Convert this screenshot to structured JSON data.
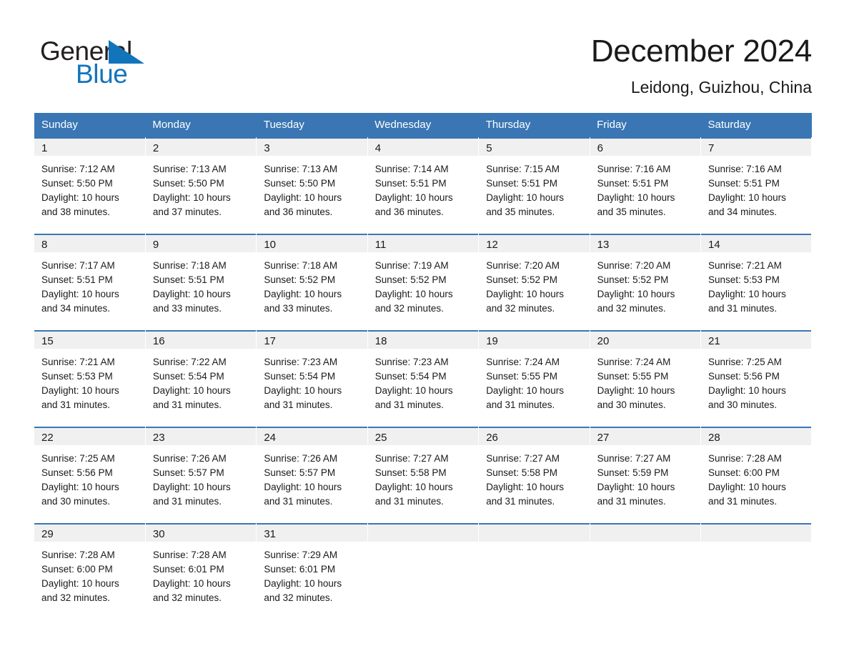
{
  "brand": {
    "name_dark": "General",
    "name_light": "Blue",
    "triangle_color": "#1275bc",
    "logo_icon": "triangle-icon"
  },
  "header": {
    "title": "December 2024",
    "subtitle": "Leidong, Guizhou, China"
  },
  "theme": {
    "header_blue": "#3a76b4",
    "date_band": "#f0f0f0",
    "text": "#1a1a1a"
  },
  "weekdays": [
    "Sunday",
    "Monday",
    "Tuesday",
    "Wednesday",
    "Thursday",
    "Friday",
    "Saturday"
  ],
  "weeks": [
    [
      {
        "date": "1",
        "sunrise": "Sunrise: 7:12 AM",
        "sunset": "Sunset: 5:50 PM",
        "daylight_line1": "Daylight: 10 hours",
        "daylight_line2": "and 38 minutes."
      },
      {
        "date": "2",
        "sunrise": "Sunrise: 7:13 AM",
        "sunset": "Sunset: 5:50 PM",
        "daylight_line1": "Daylight: 10 hours",
        "daylight_line2": "and 37 minutes."
      },
      {
        "date": "3",
        "sunrise": "Sunrise: 7:13 AM",
        "sunset": "Sunset: 5:50 PM",
        "daylight_line1": "Daylight: 10 hours",
        "daylight_line2": "and 36 minutes."
      },
      {
        "date": "4",
        "sunrise": "Sunrise: 7:14 AM",
        "sunset": "Sunset: 5:51 PM",
        "daylight_line1": "Daylight: 10 hours",
        "daylight_line2": "and 36 minutes."
      },
      {
        "date": "5",
        "sunrise": "Sunrise: 7:15 AM",
        "sunset": "Sunset: 5:51 PM",
        "daylight_line1": "Daylight: 10 hours",
        "daylight_line2": "and 35 minutes."
      },
      {
        "date": "6",
        "sunrise": "Sunrise: 7:16 AM",
        "sunset": "Sunset: 5:51 PM",
        "daylight_line1": "Daylight: 10 hours",
        "daylight_line2": "and 35 minutes."
      },
      {
        "date": "7",
        "sunrise": "Sunrise: 7:16 AM",
        "sunset": "Sunset: 5:51 PM",
        "daylight_line1": "Daylight: 10 hours",
        "daylight_line2": "and 34 minutes."
      }
    ],
    [
      {
        "date": "8",
        "sunrise": "Sunrise: 7:17 AM",
        "sunset": "Sunset: 5:51 PM",
        "daylight_line1": "Daylight: 10 hours",
        "daylight_line2": "and 34 minutes."
      },
      {
        "date": "9",
        "sunrise": "Sunrise: 7:18 AM",
        "sunset": "Sunset: 5:51 PM",
        "daylight_line1": "Daylight: 10 hours",
        "daylight_line2": "and 33 minutes."
      },
      {
        "date": "10",
        "sunrise": "Sunrise: 7:18 AM",
        "sunset": "Sunset: 5:52 PM",
        "daylight_line1": "Daylight: 10 hours",
        "daylight_line2": "and 33 minutes."
      },
      {
        "date": "11",
        "sunrise": "Sunrise: 7:19 AM",
        "sunset": "Sunset: 5:52 PM",
        "daylight_line1": "Daylight: 10 hours",
        "daylight_line2": "and 32 minutes."
      },
      {
        "date": "12",
        "sunrise": "Sunrise: 7:20 AM",
        "sunset": "Sunset: 5:52 PM",
        "daylight_line1": "Daylight: 10 hours",
        "daylight_line2": "and 32 minutes."
      },
      {
        "date": "13",
        "sunrise": "Sunrise: 7:20 AM",
        "sunset": "Sunset: 5:52 PM",
        "daylight_line1": "Daylight: 10 hours",
        "daylight_line2": "and 32 minutes."
      },
      {
        "date": "14",
        "sunrise": "Sunrise: 7:21 AM",
        "sunset": "Sunset: 5:53 PM",
        "daylight_line1": "Daylight: 10 hours",
        "daylight_line2": "and 31 minutes."
      }
    ],
    [
      {
        "date": "15",
        "sunrise": "Sunrise: 7:21 AM",
        "sunset": "Sunset: 5:53 PM",
        "daylight_line1": "Daylight: 10 hours",
        "daylight_line2": "and 31 minutes."
      },
      {
        "date": "16",
        "sunrise": "Sunrise: 7:22 AM",
        "sunset": "Sunset: 5:54 PM",
        "daylight_line1": "Daylight: 10 hours",
        "daylight_line2": "and 31 minutes."
      },
      {
        "date": "17",
        "sunrise": "Sunrise: 7:23 AM",
        "sunset": "Sunset: 5:54 PM",
        "daylight_line1": "Daylight: 10 hours",
        "daylight_line2": "and 31 minutes."
      },
      {
        "date": "18",
        "sunrise": "Sunrise: 7:23 AM",
        "sunset": "Sunset: 5:54 PM",
        "daylight_line1": "Daylight: 10 hours",
        "daylight_line2": "and 31 minutes."
      },
      {
        "date": "19",
        "sunrise": "Sunrise: 7:24 AM",
        "sunset": "Sunset: 5:55 PM",
        "daylight_line1": "Daylight: 10 hours",
        "daylight_line2": "and 31 minutes."
      },
      {
        "date": "20",
        "sunrise": "Sunrise: 7:24 AM",
        "sunset": "Sunset: 5:55 PM",
        "daylight_line1": "Daylight: 10 hours",
        "daylight_line2": "and 30 minutes."
      },
      {
        "date": "21",
        "sunrise": "Sunrise: 7:25 AM",
        "sunset": "Sunset: 5:56 PM",
        "daylight_line1": "Daylight: 10 hours",
        "daylight_line2": "and 30 minutes."
      }
    ],
    [
      {
        "date": "22",
        "sunrise": "Sunrise: 7:25 AM",
        "sunset": "Sunset: 5:56 PM",
        "daylight_line1": "Daylight: 10 hours",
        "daylight_line2": "and 30 minutes."
      },
      {
        "date": "23",
        "sunrise": "Sunrise: 7:26 AM",
        "sunset": "Sunset: 5:57 PM",
        "daylight_line1": "Daylight: 10 hours",
        "daylight_line2": "and 31 minutes."
      },
      {
        "date": "24",
        "sunrise": "Sunrise: 7:26 AM",
        "sunset": "Sunset: 5:57 PM",
        "daylight_line1": "Daylight: 10 hours",
        "daylight_line2": "and 31 minutes."
      },
      {
        "date": "25",
        "sunrise": "Sunrise: 7:27 AM",
        "sunset": "Sunset: 5:58 PM",
        "daylight_line1": "Daylight: 10 hours",
        "daylight_line2": "and 31 minutes."
      },
      {
        "date": "26",
        "sunrise": "Sunrise: 7:27 AM",
        "sunset": "Sunset: 5:58 PM",
        "daylight_line1": "Daylight: 10 hours",
        "daylight_line2": "and 31 minutes."
      },
      {
        "date": "27",
        "sunrise": "Sunrise: 7:27 AM",
        "sunset": "Sunset: 5:59 PM",
        "daylight_line1": "Daylight: 10 hours",
        "daylight_line2": "and 31 minutes."
      },
      {
        "date": "28",
        "sunrise": "Sunrise: 7:28 AM",
        "sunset": "Sunset: 6:00 PM",
        "daylight_line1": "Daylight: 10 hours",
        "daylight_line2": "and 31 minutes."
      }
    ],
    [
      {
        "date": "29",
        "sunrise": "Sunrise: 7:28 AM",
        "sunset": "Sunset: 6:00 PM",
        "daylight_line1": "Daylight: 10 hours",
        "daylight_line2": "and 32 minutes."
      },
      {
        "date": "30",
        "sunrise": "Sunrise: 7:28 AM",
        "sunset": "Sunset: 6:01 PM",
        "daylight_line1": "Daylight: 10 hours",
        "daylight_line2": "and 32 minutes."
      },
      {
        "date": "31",
        "sunrise": "Sunrise: 7:29 AM",
        "sunset": "Sunset: 6:01 PM",
        "daylight_line1": "Daylight: 10 hours",
        "daylight_line2": "and 32 minutes."
      },
      {
        "date": "",
        "sunrise": "",
        "sunset": "",
        "daylight_line1": "",
        "daylight_line2": ""
      },
      {
        "date": "",
        "sunrise": "",
        "sunset": "",
        "daylight_line1": "",
        "daylight_line2": ""
      },
      {
        "date": "",
        "sunrise": "",
        "sunset": "",
        "daylight_line1": "",
        "daylight_line2": ""
      },
      {
        "date": "",
        "sunrise": "",
        "sunset": "",
        "daylight_line1": "",
        "daylight_line2": ""
      }
    ]
  ]
}
